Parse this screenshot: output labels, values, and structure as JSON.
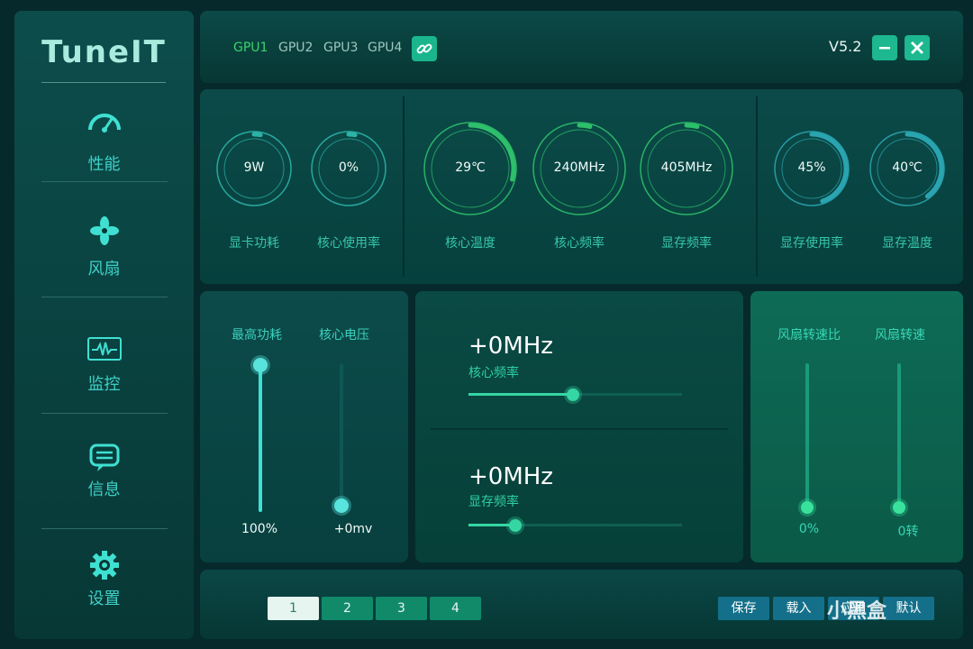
{
  "app": {
    "title": "TuneIT",
    "version": "V5.2"
  },
  "sidebar": {
    "items": [
      {
        "label": "性能",
        "icon": "speedometer-icon"
      },
      {
        "label": "风扇",
        "icon": "fan-icon"
      },
      {
        "label": "监控",
        "icon": "monitor-icon"
      },
      {
        "label": "信息",
        "icon": "chat-icon"
      },
      {
        "label": "设置",
        "icon": "gear-icon"
      }
    ]
  },
  "header": {
    "gpu_tabs": [
      "GPU1",
      "GPU2",
      "GPU3",
      "GPU4"
    ],
    "active_gpu": "GPU1"
  },
  "gauges": [
    {
      "value": "9W",
      "label": "显卡功耗",
      "level": 0.02
    },
    {
      "value": "0%",
      "label": "核心使用率",
      "level": 0.0
    },
    {
      "value": "29℃",
      "label": "核心温度",
      "level": 0.29
    },
    {
      "value": "240MHz",
      "label": "核心频率",
      "level": 0.04
    },
    {
      "value": "405MHz",
      "label": "显存频率",
      "level": 0.04
    },
    {
      "value": "45%",
      "label": "显存使用率",
      "level": 0.45
    },
    {
      "value": "40℃",
      "label": "显存温度",
      "level": 0.4
    }
  ],
  "power": {
    "power_limit": {
      "label": "最高功耗",
      "value": "100%",
      "level": 1.0
    },
    "core_voltage": {
      "label": "核心电压",
      "value": "+0mv",
      "level": 0.0
    }
  },
  "clocks": {
    "core": {
      "value": "+0MHz",
      "label": "核心频率",
      "level": 0.49
    },
    "memory": {
      "value": "+0MHz",
      "label": "显存频率",
      "level": 0.22
    }
  },
  "fan": {
    "ratio": {
      "label": "风扇转速比",
      "value": "0%",
      "level": 0.0
    },
    "speed": {
      "label": "风扇转速",
      "value": "0转",
      "level": 0.0
    }
  },
  "bottom": {
    "profiles": [
      "1",
      "2",
      "3",
      "4"
    ],
    "active_profile": "1",
    "actions": {
      "save": "保存",
      "load": "载入",
      "apply": "应用",
      "default": "默认"
    }
  },
  "watermark": "小黑盒",
  "colors": {
    "accent": "#1db88f",
    "active_tab": "#38d66a",
    "gauge_ring": "#2bb39a"
  }
}
